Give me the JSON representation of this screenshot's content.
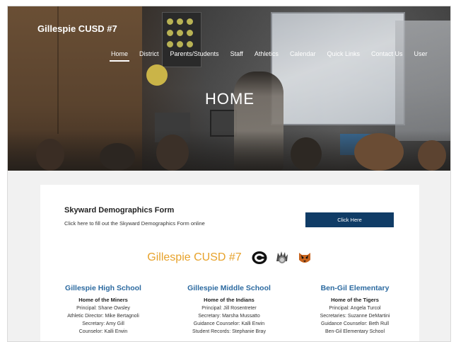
{
  "site": {
    "title": "Gillespie CUSD #7"
  },
  "nav": {
    "items": [
      {
        "label": "Home",
        "active": true
      },
      {
        "label": "District"
      },
      {
        "label": "Parents/Students"
      },
      {
        "label": "Staff"
      },
      {
        "label": "Athletics"
      },
      {
        "label": "Calendar"
      },
      {
        "label": "Quick Links"
      },
      {
        "label": "Contact Us"
      },
      {
        "label": "User"
      }
    ]
  },
  "hero": {
    "title": "HOME"
  },
  "form_section": {
    "title": "Skyward Demographics Form",
    "description": "Click here to fill out the Skyward Demographics Form online",
    "button_label": "Click Here"
  },
  "brand": {
    "name": "Gillespie CUSD #7",
    "accent_color": "#e7a22b",
    "logos": [
      "g-logo-icon",
      "indian-head-icon",
      "tiger-icon"
    ]
  },
  "schools": [
    {
      "name": "Gillespie High School",
      "home": "Home of the Miners",
      "lines": [
        "Principal: Shane Owsley",
        "Athletic Director: Mike Bertagnoli",
        "Secretary: Amy Gill",
        "Counselor: Kalli Erwin"
      ]
    },
    {
      "name": "Gillespie Middle School",
      "home": "Home of the Indians",
      "lines": [
        "Principal: Jill Rosentreter",
        "Secretary: Marsha Mussatto",
        "Guidance Counselor: Kalli Erwin",
        "Student Records:  Stephanie Bray"
      ]
    },
    {
      "name": "Ben-Gil Elementary",
      "home": "Home of the Tigers",
      "lines": [
        "Principal: Angela Turcol",
        "Secretaries: Suzanne DeMartini",
        "Guidance Counselor: Beth Rull",
        "Ben-Gil Elementary School"
      ]
    }
  ],
  "colors": {
    "nav_button": "#103c66",
    "school_name": "#2c6aa0"
  }
}
